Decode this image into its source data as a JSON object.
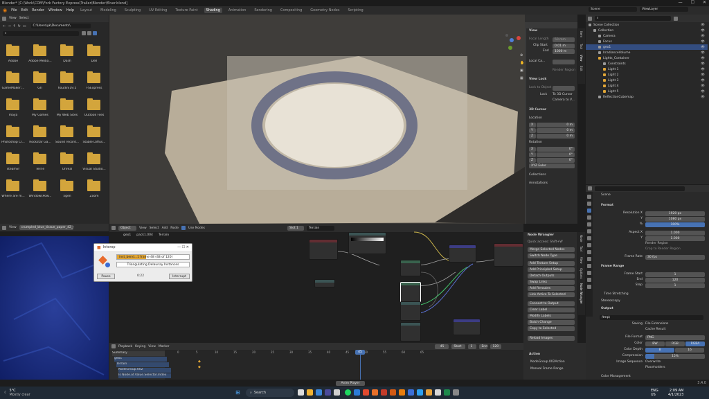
{
  "window": {
    "title": "Blender* [C:\\Work\\CDM\\Fork Factory Express\\Trailer\\Blender\\fliver.blend]",
    "controls": [
      "—",
      "☐",
      "✕"
    ]
  },
  "menu": {
    "items": [
      "File",
      "Edit",
      "Render",
      "Window",
      "Help"
    ],
    "workspaces": [
      "Layout",
      "Modeling",
      "Sculpting",
      "UV Editing",
      "Texture Paint",
      "Shading",
      "Animation",
      "Rendering",
      "Compositing",
      "Geometry Nodes",
      "Scripting"
    ],
    "active_workspace": "Shading",
    "scene": "Scene",
    "view_layer": "ViewLayer"
  },
  "file_browser": {
    "menu": [
      "View",
      "Select"
    ],
    "path": "C:\\Users\\yk\\Documents\\",
    "folders": [
      "Adobe",
      "Adobe Media...",
      "Dash",
      "Dell",
      "GameMaker:...",
      "GIT",
      "houdini19.5",
      "FSExpress",
      "maya",
      "My Games",
      "My Web Sites",
      "Outlook Files",
      "Photoshop Cl...",
      "Rockstar Ga...",
      "Sound record...",
      "Stable Diffus...",
      "steamvr",
      "Terrie",
      "Unreal",
      "Visual Studio...",
      "Where are m...",
      "WindowsPow...",
      "xgen",
      "Zoom"
    ]
  },
  "viewport": {
    "header": [
      "Object Mode",
      "View",
      "Select",
      "Add",
      "Object"
    ],
    "transform": "Global",
    "tabs": [
      "Item",
      "Tool",
      "View",
      "Edit"
    ],
    "view_panel": {
      "title": "View",
      "focal_length": "50 mm",
      "clip_start": "0.01 m",
      "clip_end": "1000 m",
      "local_camera": "Local Ca...",
      "render_region": "Render Region",
      "view_lock": "View Lock",
      "lock_object": "Lock to Object",
      "lock": "Lock",
      "lock_3d_cursor": "To 3D Cursor",
      "camera_to_view": "Camera to V..."
    },
    "cursor_panel": {
      "title": "3D Cursor",
      "location": "Location",
      "loc": [
        [
          "X",
          "0 m"
        ],
        [
          "Y",
          "0 m"
        ],
        [
          "Z",
          "0 m"
        ]
      ],
      "rotation": "Rotation",
      "rot": [
        [
          "X",
          "0°"
        ],
        [
          "Y",
          "0°"
        ],
        [
          "Z",
          "0°"
        ]
      ],
      "rotation_mode": "XYZ Euler"
    },
    "collapsed": [
      "Collections",
      "Annotations"
    ],
    "labels": {
      "focal": "Focal Length",
      "clip_start": "Clip Start",
      "end": "End",
      "local_camera": "Local Ca..."
    }
  },
  "outliner": {
    "search_placeholder": "",
    "items": [
      {
        "label": "Scene Collection",
        "indent": 0
      },
      {
        "label": "Collection",
        "indent": 1
      },
      {
        "label": "Camera",
        "indent": 2
      },
      {
        "label": "Focus",
        "indent": 2
      },
      {
        "label": "geo1",
        "indent": 2,
        "selected": true
      },
      {
        "label": "IrradianceVolume",
        "indent": 2
      },
      {
        "label": "Lights_Container",
        "indent": 2
      },
      {
        "label": "Constraints",
        "indent": 3
      },
      {
        "label": "Light 1",
        "indent": 3
      },
      {
        "label": "Light 2",
        "indent": 3
      },
      {
        "label": "Light 3",
        "indent": 3
      },
      {
        "label": "Light 4",
        "indent": 3
      },
      {
        "label": "Light 5",
        "indent": 3
      },
      {
        "label": "ReflectionCubemap",
        "indent": 2
      }
    ]
  },
  "properties": {
    "scene_label": "Scene",
    "format_title": "Format",
    "rows": [
      [
        "Resolution X",
        "1920 px"
      ],
      [
        "Y",
        "1080 px"
      ],
      [
        "%",
        "100%"
      ],
      [
        "Aspect X",
        "1.000"
      ],
      [
        "Y",
        "1.000"
      ]
    ],
    "render_region": "Render Region",
    "crop": "Crop to Render Region",
    "frame_rate_label": "Frame Rate",
    "frame_rate": "30 fps",
    "frame_range_title": "Frame Range",
    "frame_rows": [
      [
        "Frame Start",
        "1"
      ],
      [
        "End",
        "120"
      ],
      [
        "Step",
        "1"
      ]
    ],
    "time_stretching": "Time Stretching",
    "stereoscopy": "Stereoscopy",
    "output_title": "Output",
    "output_path": "/tmp\\",
    "saving": "Saving",
    "file_ext": "File Extensions",
    "cache_result": "Cache Result",
    "file_format_label": "File Format",
    "file_format": "PNG",
    "color_label": "Color",
    "color_opts": [
      "BW",
      "RGB",
      "RGBA"
    ],
    "depth_label": "Color Depth",
    "depth_opts": [
      "8",
      "16"
    ],
    "compression_label": "Compression",
    "compression": "15%",
    "image_seq": "Image Sequence",
    "overwrite": "Overwrite",
    "placeholders": "Placeholders",
    "color_mgmt": "Color Management",
    "version": "3.4.0"
  },
  "image_editor": {
    "menu": [
      "View"
    ],
    "image": "crumpled_blue_tissue_paper_42_66_4..."
  },
  "node_editor": {
    "header": [
      "Object",
      "View",
      "Select",
      "Add",
      "Node"
    ],
    "use_nodes": "Use Nodes",
    "slot": "Slot 1",
    "material": "Terrain",
    "breadcrumb": [
      "geo1",
      "pack1.004",
      "Terrain"
    ],
    "side_tabs": [
      "Node",
      "Tool",
      "View",
      "Options",
      "Node Wrangler"
    ],
    "wrangler": {
      "title": "Node Wrangler",
      "quick": "Quick access: Shift+W",
      "items": [
        "Merge Selected Nodes",
        "Switch Node Type",
        "Add Texture Setup",
        "Add Principled Setup",
        "Detach Outputs",
        "Swap Links",
        "Add Reroutes",
        "Link Active To Selected",
        "Connect to Output",
        "Clear Label",
        "Modify Labels",
        "Batch Change",
        "Copy to Selected",
        "Reload Images"
      ]
    }
  },
  "dialog": {
    "title": "Interop",
    "progress": "inst_bend...1 frame 48 (48 of 120)",
    "message": "Triangulating Delaunay Instances",
    "pause": "Pause",
    "time": "0:22",
    "interrupt": "Interrupt"
  },
  "timeline": {
    "menu": [
      "Playback",
      "Keying",
      "View",
      "Marker"
    ],
    "current": "45",
    "start_label": "Start",
    "start": "1",
    "end_label": "End",
    "end": "120",
    "ticks": [
      "0",
      "5",
      "10",
      "15",
      "20",
      "25",
      "30",
      "35",
      "40",
      "45",
      "50",
      "55",
      "60",
      "65"
    ],
    "channels": [
      "Summary",
      "geo1",
      "Terrain",
      "NodeGroup.002",
      "Is Node.of.Value.Selector.Index"
    ],
    "action": {
      "title": "Action",
      "name": "NodeGroup.002Action",
      "manual": "Manual Frame Range"
    }
  },
  "statusbar": {
    "anim_player": "Anim Player",
    "version": "3.4.0"
  },
  "taskbar": {
    "weather_temp": "5°C",
    "weather_desc": "Mostly clear",
    "search": "Search",
    "lang": "ENG",
    "region": "US",
    "time": "2:09 AM",
    "date": "4/1/2023"
  }
}
